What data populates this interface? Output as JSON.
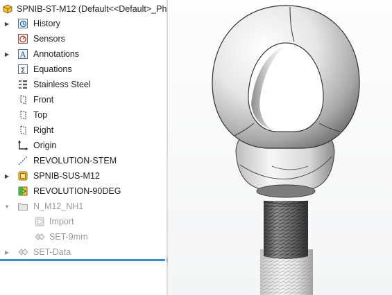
{
  "tree": {
    "root": {
      "label": "SPNIB-ST-M12  (Default<<Default>_Pho",
      "icon": "part-icon"
    },
    "items": [
      {
        "label": "History",
        "icon": "history-icon",
        "expandable": true
      },
      {
        "label": "Sensors",
        "icon": "sensors-icon",
        "expandable": false
      },
      {
        "label": "Annotations",
        "icon": "annotations-icon",
        "expandable": true
      },
      {
        "label": "Equations",
        "icon": "equations-icon",
        "expandable": false
      },
      {
        "label": "Stainless Steel",
        "icon": "material-icon",
        "expandable": false
      },
      {
        "label": "Front",
        "icon": "plane-icon",
        "expandable": false
      },
      {
        "label": "Top",
        "icon": "plane-icon",
        "expandable": false
      },
      {
        "label": "Right",
        "icon": "plane-icon",
        "expandable": false
      },
      {
        "label": "Origin",
        "icon": "origin-icon",
        "expandable": false
      },
      {
        "label": "REVOLUTION-STEM",
        "icon": "sketch-icon",
        "expandable": false
      },
      {
        "label": "SPNIB-SUS-M12",
        "icon": "base-part-icon",
        "expandable": true
      },
      {
        "label": "REVOLUTION-90DEG",
        "icon": "revolve-icon",
        "expandable": false
      },
      {
        "label": "N_M12_NH1",
        "icon": "folder-icon",
        "expandable": true,
        "suppressed": true
      },
      {
        "label": "Import",
        "icon": "import-icon",
        "expandable": false,
        "suppressed": true
      },
      {
        "label": "SET-9mm",
        "icon": "set-icon",
        "expandable": false,
        "suppressed": true
      },
      {
        "label": "SET-Data",
        "icon": "set-icon",
        "expandable": true,
        "suppressed": true
      }
    ]
  },
  "colors": {
    "rollback_bar": "#3b8bd0",
    "part_icon": "#f0c23a",
    "revolve_icon": "#f0c23a"
  },
  "viewport": {
    "model": "eye-bolt-model"
  }
}
